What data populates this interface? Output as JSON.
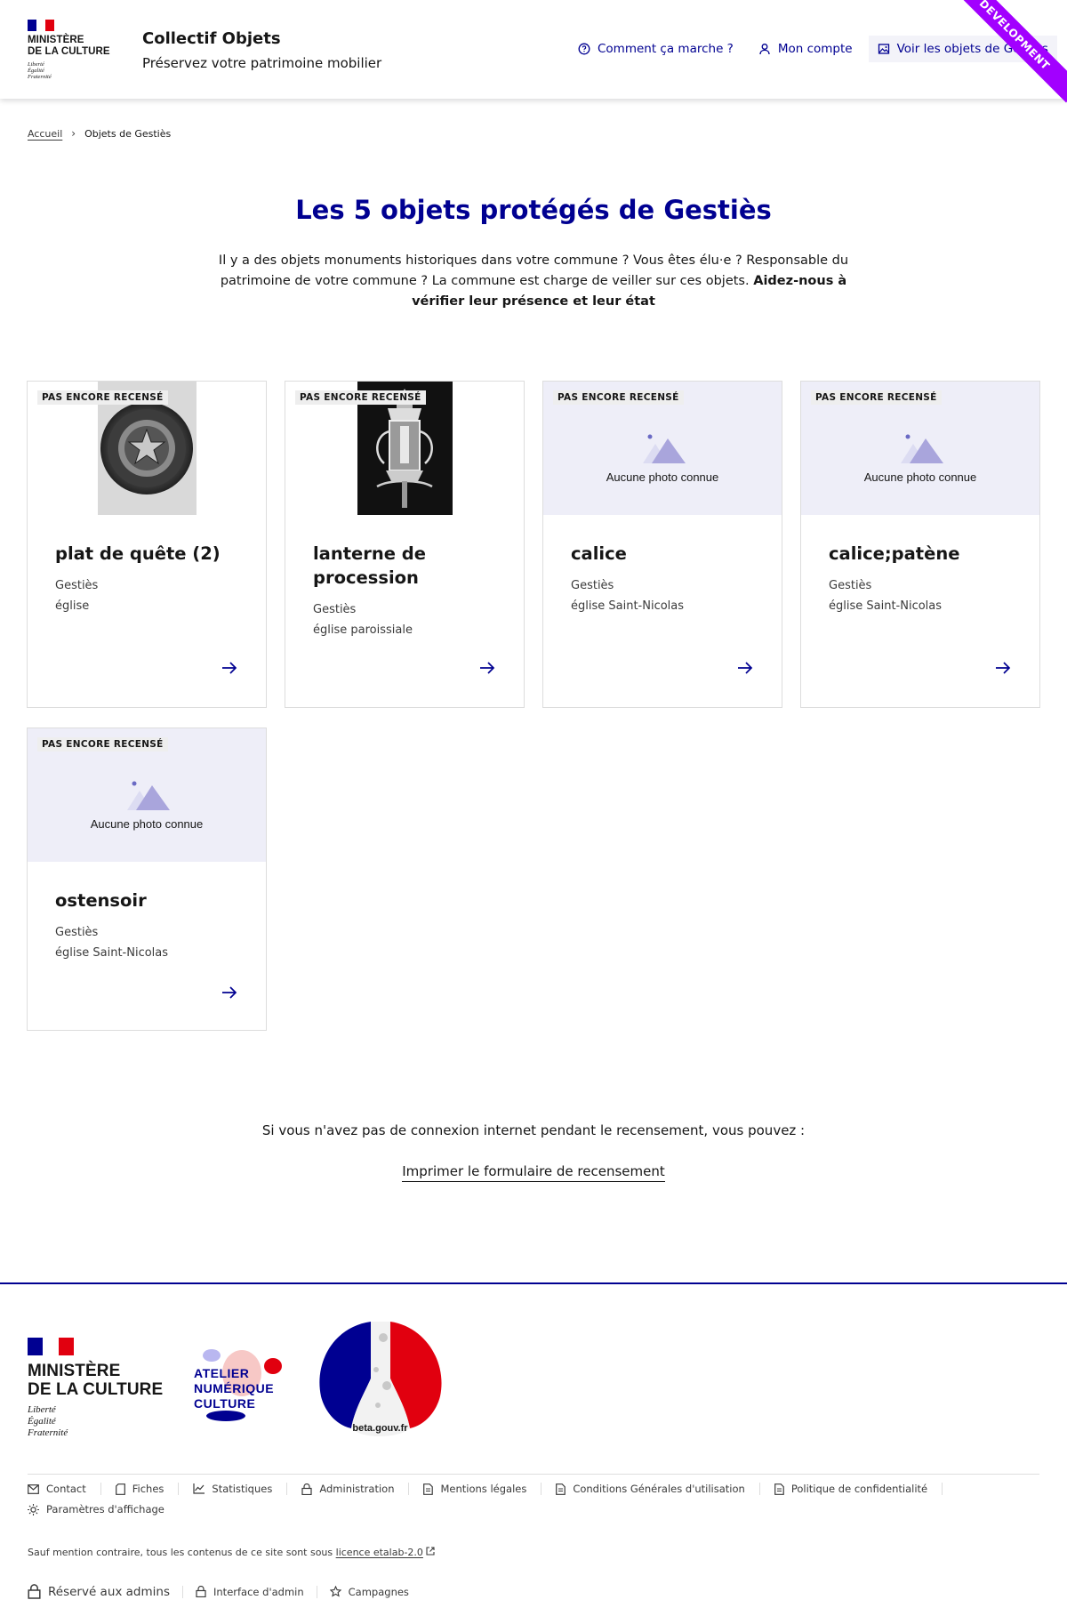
{
  "header": {
    "ministry_line1": "Ministère",
    "ministry_line2": "de la Culture",
    "devise_1": "Liberté",
    "devise_2": "Égalité",
    "devise_3": "Fraternité",
    "service_title": "Collectif Objets",
    "service_tagline": "Préservez votre patrimoine mobilier",
    "nav": [
      {
        "label": "Comment ça marche ?",
        "icon": "question-circle-icon"
      },
      {
        "label": "Mon compte",
        "icon": "user-icon"
      },
      {
        "label": "Voir les objets de Gestiès",
        "icon": "image-icon"
      }
    ],
    "ribbon": "DEVELOPMENT"
  },
  "breadcrumb": {
    "home": "Accueil",
    "current": "Objets de Gestiès"
  },
  "main": {
    "title": "Les 5 objets protégés de Gestiès",
    "intro_text": "Il y a des objets monuments historiques dans votre commune ? Vous êtes élu·e ? Responsable du patrimoine de votre commune ? La commune est charge de veiller sur ces objets.",
    "intro_bold": "Aidez-nous à vérifier leur présence et leur état"
  },
  "cards": [
    {
      "badge": "PAS ENCORE RECENSÉ",
      "title": "plat de quête (2)",
      "commune": "Gestiès",
      "edifice": "église",
      "has_photo": true
    },
    {
      "badge": "PAS ENCORE RECENSÉ",
      "title": "lanterne de procession",
      "commune": "Gestiès",
      "edifice": "église paroissiale",
      "has_photo": true
    },
    {
      "badge": "PAS ENCORE RECENSÉ",
      "title": "calice",
      "commune": "Gestiès",
      "edifice": "église Saint-Nicolas",
      "has_photo": false,
      "no_photo_text": "Aucune photo connue"
    },
    {
      "badge": "PAS ENCORE RECENSÉ",
      "title": "calice;patène",
      "commune": "Gestiès",
      "edifice": "église Saint-Nicolas",
      "has_photo": false,
      "no_photo_text": "Aucune photo connue"
    },
    {
      "badge": "PAS ENCORE RECENSÉ",
      "title": "ostensoir",
      "commune": "Gestiès",
      "edifice": "église Saint-Nicolas",
      "has_photo": false,
      "no_photo_text": "Aucune photo connue"
    }
  ],
  "offline": {
    "text": "Si vous n'avez pas de connexion internet pendant le recensement, vous pouvez :",
    "print_link": "Imprimer le formulaire de recensement"
  },
  "footer": {
    "anc_line1": "ATELIER",
    "anc_line2": "NUMÉRIQUE",
    "anc_line3": "CULTURE",
    "beta_text": "beta.gouv.fr",
    "links": [
      {
        "label": "Contact",
        "icon": "mail-icon"
      },
      {
        "label": "Fiches",
        "icon": "document-icon"
      },
      {
        "label": "Statistiques",
        "icon": "chart-icon"
      },
      {
        "label": "Administration",
        "icon": "lock-icon"
      },
      {
        "label": "Mentions légales",
        "icon": "file-text-icon"
      },
      {
        "label": "Conditions Générales d'utilisation",
        "icon": "file-text-icon"
      },
      {
        "label": "Politique de confidentialité",
        "icon": "file-text-icon"
      },
      {
        "label": "Paramètres d'affichage",
        "icon": "sun-icon"
      }
    ],
    "license_prefix": "Sauf mention contraire, tous les contenus de ce site sont sous",
    "license_link": "licence etalab-2.0",
    "admin_reserved": "Réservé aux admins",
    "admin_interface": "Interface d'admin",
    "campaigns": "Campagnes"
  },
  "colors": {
    "primary": "#000091",
    "badge_bg": "#eeeeee",
    "noimg_bg": "#eeeef8",
    "ribbon": "#a200ff",
    "flag_blue": "#000091",
    "flag_red": "#e1000f"
  }
}
